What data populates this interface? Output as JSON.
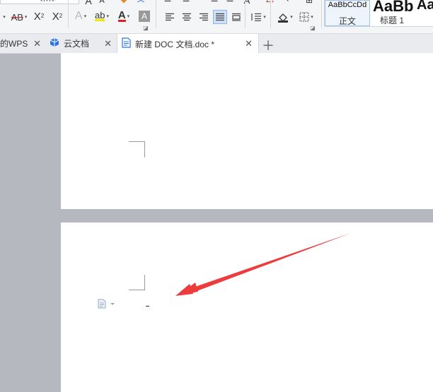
{
  "ribbon": {
    "font_name": "宋体",
    "styles": [
      {
        "preview": "AaBbCcDd",
        "name": "正文"
      },
      {
        "preview": "AaBb",
        "name": "标题 1"
      },
      {
        "preview": "Aa",
        "name": ""
      }
    ]
  },
  "tabs": [
    {
      "label": "的WPS",
      "icon": "wps-icon",
      "active": false
    },
    {
      "label": "云文档",
      "icon": "cloud-docs-icon",
      "active": false
    },
    {
      "label": "新建 DOC 文档.doc *",
      "icon": "doc-file-icon",
      "active": true
    }
  ],
  "colors": {
    "accent_blue": "#2b74e4",
    "highlight_yellow": "#f5e600",
    "font_red": "#e02020",
    "arrow_red": "#ee3b3b"
  }
}
